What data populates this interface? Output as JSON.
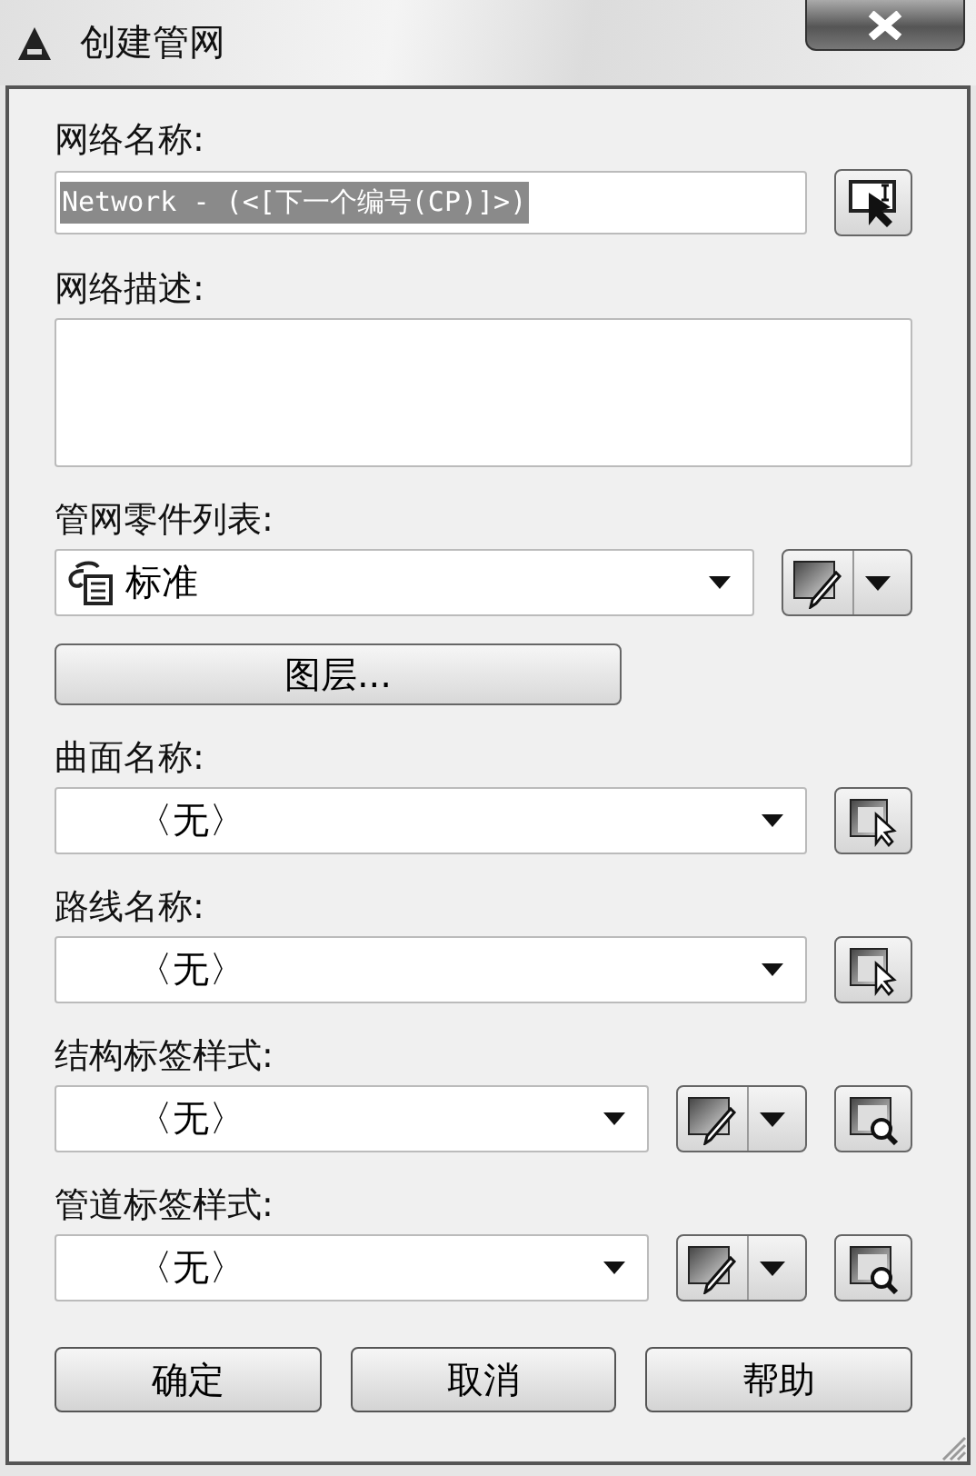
{
  "window": {
    "title": "创建管网"
  },
  "fields": [
    {
      "kind": "text",
      "label": "网络名称:",
      "value": "Network - (<[下一个编号(CP)]>)",
      "value_selected": true,
      "tools": [
        {
          "kind": "pick-text"
        }
      ]
    },
    {
      "kind": "textarea",
      "label": "网络描述:"
    },
    {
      "kind": "combo",
      "label": "管网零件列表:",
      "value": "标准",
      "item_icon": true,
      "tools": [
        {
          "kind": "edit-split"
        }
      ]
    },
    {
      "kind": "button",
      "value": "图层..."
    },
    {
      "kind": "combo",
      "label": "曲面名称:",
      "value": "〈无〉",
      "item_icon": false,
      "tools": [
        {
          "kind": "pick"
        }
      ]
    },
    {
      "kind": "combo",
      "label": "路线名称:",
      "value": "〈无〉",
      "item_icon": false,
      "tools": [
        {
          "kind": "pick"
        }
      ]
    },
    {
      "kind": "combo",
      "label": "结构标签样式:",
      "value": "〈无〉",
      "item_icon": false,
      "tools": [
        {
          "kind": "edit-split"
        },
        {
          "kind": "browse"
        }
      ]
    },
    {
      "kind": "combo",
      "label": "管道标签样式:",
      "value": "〈无〉",
      "item_icon": false,
      "tools": [
        {
          "kind": "edit-split"
        },
        {
          "kind": "browse"
        }
      ]
    }
  ],
  "buttons": [
    "确定",
    "取消",
    "帮助"
  ]
}
